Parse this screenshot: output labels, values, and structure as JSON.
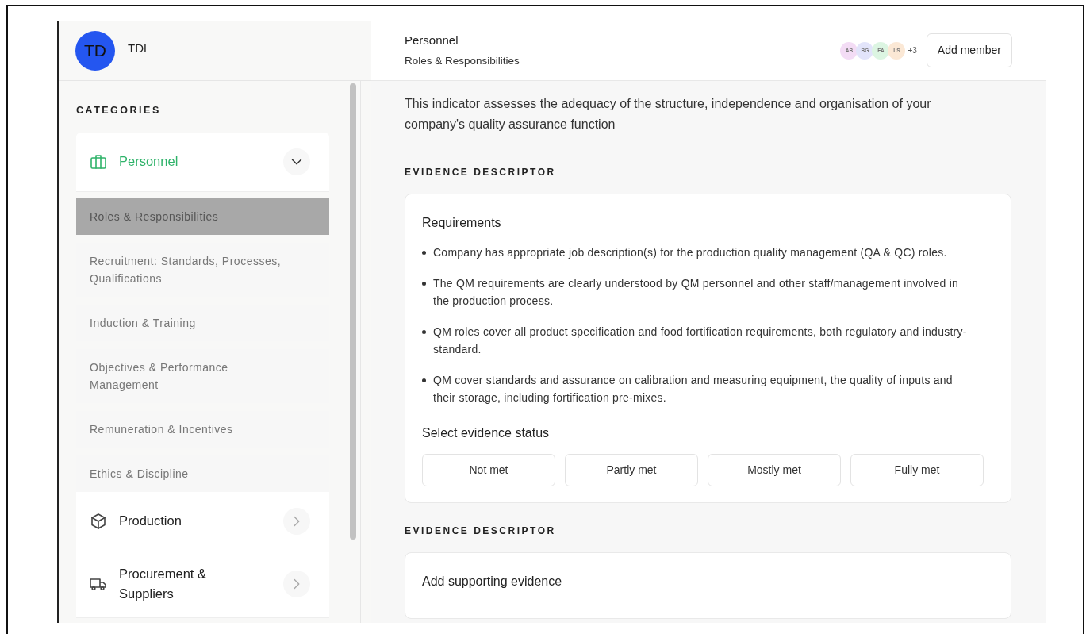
{
  "workspace": {
    "avatar": "TD",
    "name": "TDL"
  },
  "sidebar": {
    "heading": "CATEGORIES",
    "categories": [
      {
        "label": "Personnel",
        "selected": true,
        "expanded": true,
        "children": [
          {
            "label": "Roles & Responsibilities",
            "selected": true
          },
          {
            "label": "Recruitment: Standards, Processes, Qualifications",
            "selected": false
          },
          {
            "label": "Induction & Training",
            "selected": false
          },
          {
            "label": "Objectives & Performance Management",
            "selected": false
          },
          {
            "label": "Remuneration & Incentives",
            "selected": false
          },
          {
            "label": "Ethics & Discipline",
            "selected": false
          }
        ]
      },
      {
        "label": "Production",
        "selected": false,
        "expanded": false
      },
      {
        "label": "Procurement & Suppliers",
        "selected": false,
        "expanded": false
      }
    ]
  },
  "header": {
    "title": "Personnel",
    "subtitle": "Roles & Responsibilities",
    "members": [
      {
        "initials": "AB",
        "color": "#f3dcf5"
      },
      {
        "initials": "BG",
        "color": "#e2e4fa"
      },
      {
        "initials": "FA",
        "color": "#dcf5e2"
      },
      {
        "initials": "LS",
        "color": "#fbe8d5"
      }
    ],
    "more": "+3",
    "add_button": "Add member"
  },
  "description": "This indicator assesses the adequacy of the structure, independence and organisation of your company's quality assurance function",
  "sections": [
    {
      "heading": "EVIDENCE DESCRIPTOR",
      "card_title": "Requirements",
      "requirements": [
        "Company has appropriate job description(s) for the production quality management (QA & QC) roles.",
        "The QM requirements are clearly understood by QM personnel and other staff/management involved in the production process.",
        "QM roles cover all product specification and food fortification requirements, both regulatory and industry-standard.",
        "QM cover standards and assurance on calibration and measuring equipment, the quality of inputs and their storage, including fortification pre-mixes."
      ],
      "status_label": "Select evidence status",
      "statuses": [
        {
          "label": "Not met",
          "selected": false
        },
        {
          "label": "Partly met",
          "selected": false
        },
        {
          "label": "Mostly met",
          "selected": false
        },
        {
          "label": "Fully met",
          "selected": false
        }
      ]
    },
    {
      "heading": "EVIDENCE DESCRIPTOR",
      "card_title": "Add supporting evidence"
    }
  ]
}
